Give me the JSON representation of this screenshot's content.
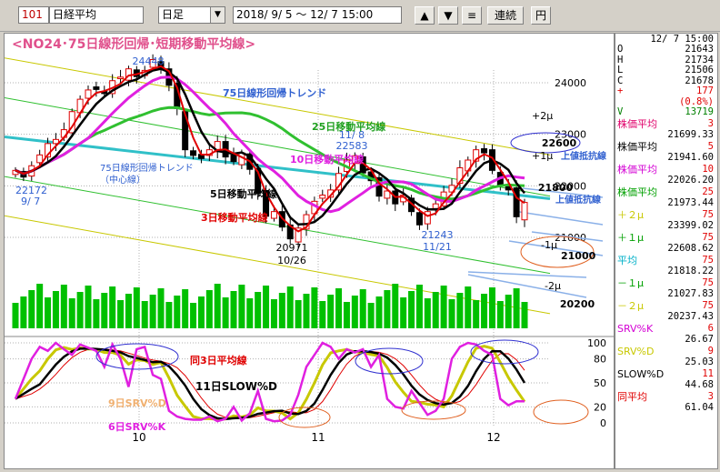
{
  "toolbar": {
    "code": "101",
    "name": "日経平均",
    "period": "日足",
    "range": "2018/ 9/ 5 ～ 12/ 7 15:00",
    "up_label": "▲",
    "down_label": "▼",
    "menu_label": "≡",
    "continuous_label": "連続",
    "yen_label": "円"
  },
  "chart": {
    "title": "<NO24･75日線形回帰･短期移動平均線>",
    "y_ticks": [
      "24000",
      "23000",
      "22000",
      "21000"
    ],
    "osc_ticks": [
      "100",
      "80",
      "50",
      "20",
      "0"
    ],
    "x_ticks": [
      "10",
      "11",
      "12"
    ],
    "annotations": {
      "high_value": "24448",
      "low_value": "20971",
      "low_date": "10/26",
      "start_value": "22172",
      "start_date": "9/ 7",
      "nov8_date": "11/ 8",
      "nov8_value": "22583",
      "nov21_value": "21243",
      "nov21_date": "11/21",
      "plus2": "+2μ",
      "plus1": "+1μ",
      "minus1": "-1μ",
      "minus2": "-2μ",
      "resist1_value": "22600",
      "resist1_label": "上値抵抗線",
      "resist2_value": "21800",
      "resist2_label": "上値抵抗線",
      "level_21000": "21000",
      "level_20200": "20200"
    },
    "labels": {
      "trend75": "75日線形回帰トレンド",
      "ma25": "25日移動平均線",
      "ma10": "10日移動平均線",
      "ma5": "5日移動平均線",
      "ma3": "3日移動平均線",
      "center_line": "75日線形回帰トレンド",
      "center_sub": "（中心線）",
      "same3": "同3日平均線",
      "slow11": "11日SLOW%D",
      "srv9": "9日SRV%D",
      "srv6": "6日SRV%K"
    }
  },
  "side_panel": {
    "date": "12/ 7 15:00",
    "ohlc": [
      {
        "k": "O",
        "v": "21643"
      },
      {
        "k": "H",
        "v": "21734"
      },
      {
        "k": "L",
        "v": "21506"
      },
      {
        "k": "C",
        "v": "21678"
      },
      {
        "k": "+",
        "v": "177"
      },
      {
        "k": "",
        "v": "(0.8%)"
      },
      {
        "k": "V",
        "v": "13719"
      }
    ],
    "items": [
      {
        "k": "株価平均",
        "p": "3",
        "v": "21699.33",
        "color": "#e0006a"
      },
      {
        "k": "株価平均",
        "p": "5",
        "v": "21941.60",
        "color": "#000000"
      },
      {
        "k": "株価平均",
        "p": "10",
        "v": "22026.20",
        "color": "#d400d4"
      },
      {
        "k": "株価平均",
        "p": "25",
        "v": "21973.44",
        "color": "#00a000"
      },
      {
        "k": "＋２μ",
        "p": "75",
        "v": "23399.02",
        "color": "#c8c800"
      },
      {
        "k": "＋１μ",
        "p": "75",
        "v": "22608.62",
        "color": "#00a000"
      },
      {
        "k": "平均",
        "p": "75",
        "v": "21818.22",
        "color": "#00b0c8"
      },
      {
        "k": "－１μ",
        "p": "75",
        "v": "21027.83",
        "color": "#00a000"
      },
      {
        "k": "－２μ",
        "p": "75",
        "v": "20237.43",
        "color": "#c8c800"
      },
      {
        "k": "SRV%K",
        "p": "6",
        "v": "26.67",
        "color": "#d400d4"
      },
      {
        "k": "SRV%D",
        "p": "9",
        "v": "25.03",
        "color": "#c8c800"
      },
      {
        "k": "SLOW%D",
        "p": "11",
        "v": "44.68",
        "color": "#000000"
      },
      {
        "k": "同平均",
        "p": "3",
        "v": "61.04",
        "color": "#e00000"
      }
    ]
  },
  "colors": {
    "up_candle": "#e00000",
    "down_candle": "#000000",
    "volume": "#00c000",
    "trend_line": "#30c0c8",
    "ma25": "#30c030",
    "ma10": "#e020e0",
    "ma5": "#000000",
    "ma3": "#e00000",
    "band1": "#30c030",
    "band2": "#c8c800"
  }
}
